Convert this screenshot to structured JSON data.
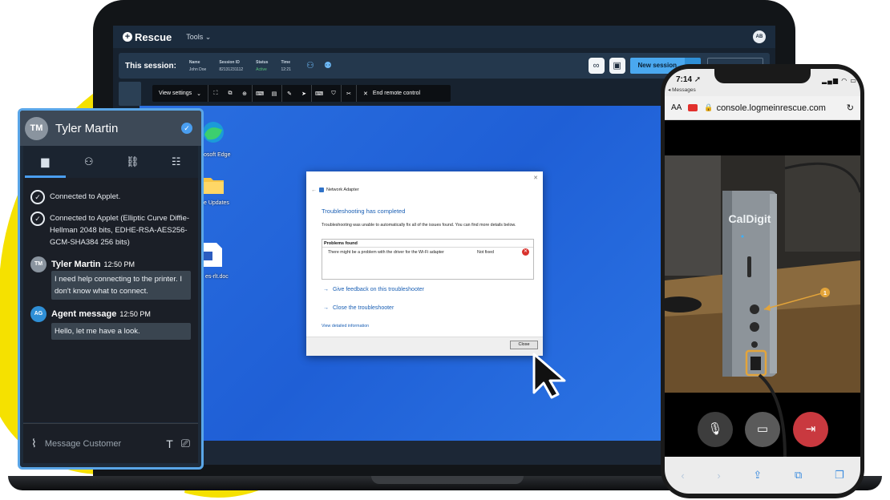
{
  "app": {
    "brand": "Rescue",
    "menu_tools": "Tools",
    "user_initials": "AB"
  },
  "session": {
    "label": "This session:",
    "name_key": "Name",
    "name_val": "John Doe",
    "id_key": "Session ID",
    "id_val": "82131231112",
    "status_key": "Status",
    "status_val": "Active",
    "time_key": "Time",
    "time_val": "12:21",
    "new_session": "New session"
  },
  "toolbar": {
    "view_settings": "View settings",
    "end_remote": "End remote control"
  },
  "desktop": {
    "edge_label": "osoft Edge",
    "updates_label": "e Updates",
    "doc_label": "es-rlt.doc"
  },
  "dialog": {
    "window_title": "Network Adapter",
    "heading": "Troubleshooting has completed",
    "description": "Troubleshooting was unable to automatically fix all of the issues found. You can find more details below.",
    "problems_header": "Problems found",
    "problem": "There might be a problem with the driver for the Wi-Fi adapter",
    "problem_status": "Not fixed",
    "link_feedback": "Give feedback on this troubleshooter",
    "link_close": "Close the troubleshooter",
    "view_detailed": "View detailed information",
    "close_button": "Close"
  },
  "chat": {
    "customer_initials": "TM",
    "customer_name": "Tyler Martin",
    "system_messages": [
      "Connected to Applet.",
      "Connected to Applet (Elliptic Curve Diffie-Hellman 2048 bits, EDHE-RSA-AES256-GCM-SHA384 256 bits)"
    ],
    "messages": [
      {
        "initials": "TM",
        "author": "Tyler Martin",
        "time": "12:50 PM",
        "text": "I need help connecting to the printer. I don't know what to connect."
      },
      {
        "initials": "AG",
        "author": "Agent message",
        "time": "12:50 PM",
        "text": "Hello, let me have a look."
      }
    ],
    "input_placeholder": "Message Customer"
  },
  "phone": {
    "time": "7:14",
    "back_label": "◂ Messages",
    "text_size": "AA",
    "url": "console.logmeinrescue.com",
    "camera_brand": "CalDigit",
    "annotation_number": "1"
  },
  "colors": {
    "accent": "#4a9ef0",
    "yellow": "#f5e100",
    "desktop_blue": "#2a6fe0",
    "error_red": "#d9322d",
    "annotation_orange": "#e3a43a"
  }
}
